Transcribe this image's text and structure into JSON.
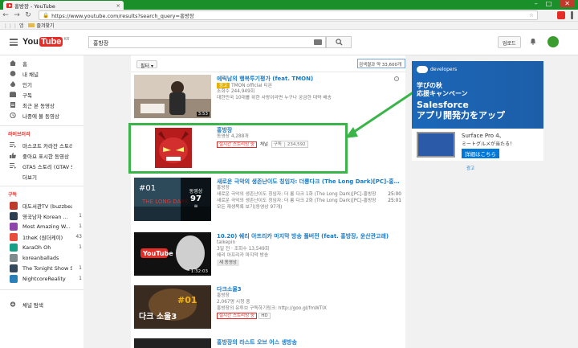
{
  "browser": {
    "tab_title": "홍방장 - YouTube",
    "tab_close": "×",
    "url": "https://www.youtube.com/results?search_query=홍방장",
    "bookmark_apps": "앱",
    "bookmark_folder": "즐겨찾기",
    "minimize": "–",
    "maximize": "□",
    "close": "✕"
  },
  "header": {
    "logo_you": "You",
    "logo_tube": "Tube",
    "logo_region": "KR",
    "search_value": "홍방장",
    "upload_label": "업로드"
  },
  "sidebar": {
    "nav": [
      {
        "label": "홈",
        "icon": "home-icon"
      },
      {
        "label": "내 채널",
        "icon": "user-icon"
      },
      {
        "label": "인기",
        "icon": "fire-icon"
      },
      {
        "label": "구독",
        "icon": "subscriptions-icon"
      },
      {
        "label": "최근 본 동영상",
        "icon": "history-icon"
      },
      {
        "label": "나중에 볼 동영상",
        "icon": "clock-icon"
      }
    ],
    "library_heading": "라이브러리",
    "library": [
      {
        "label": "마스코트 카라잔 스토리"
      },
      {
        "label": "좋아요 표시한 동영상"
      },
      {
        "label": "GTA5 스토리 (GTAV St..."
      },
      {
        "label": "더보기"
      }
    ],
    "subs_heading": "구독",
    "subs": [
      {
        "label": "대도서관TV (buzzbea...",
        "count": "",
        "color": "#c0392b"
      },
      {
        "label": "영국남자 Korean ...",
        "count": "1",
        "color": "#2c3e50"
      },
      {
        "label": "Most Amazing W...",
        "count": "1",
        "color": "#8e44ad"
      },
      {
        "label": "1theK (원더케이)",
        "count": "43",
        "color": "#e74c3c"
      },
      {
        "label": "KaraOh Oh",
        "count": "1",
        "color": "#16a085"
      },
      {
        "label": "koreanballads",
        "count": "",
        "color": "#7f8c8d"
      },
      {
        "label": "The Tonight Show Sta...",
        "count": "1",
        "color": "#34495e"
      },
      {
        "label": "NightcoreReality",
        "count": "1",
        "color": "#2980b9"
      }
    ],
    "browse_channels": "채널 탐색"
  },
  "results": {
    "filter_label": "필터 ▾",
    "count_text": "검색결과 약 33,600개",
    "items": [
      {
        "title": "에릭남의 행복투기평가 (feat. TMON)",
        "line1_badge": "광고",
        "line1": "TMON official 티몬",
        "line2": "조회수 244,949회",
        "line3": "대한민국 10대를 위한 사랑이라면 누구나 궁금한 대략 배송",
        "duration": "3:53",
        "info": "i"
      },
      {
        "title": "홍방장",
        "line1": "동영상 4,288개",
        "live_badge": "실시간 스트리밍 중",
        "channel_label": "채널",
        "subscribe_label": "구독",
        "subscribe_count": "234,592"
      },
      {
        "title": "새로운 극악의 생존난이도 칭임자: 더롱다크 (The Long Dark)[PC]-홍방장",
        "line1": "홍방장",
        "line2": "새로운 극악의 생존난이도 칭임자: 더 롱 다크 1화 (The Long Dark)[PC]-홍방장",
        "line3": "새로운 극악의 생존난이도 칭임자: 더 롱 다크 2화 (The Long Dark)[PC]-홍방장",
        "line4": "모든 재생목록 보기(동영상 97개)",
        "time1": "25:00",
        "time2": "25:01",
        "playlist_count": "97",
        "playlist_unit": "동영상"
      },
      {
        "title": "10.20) 쉐리 아프리카 마지막 방송 풀버전 (feat. 홍방장, 윤산관고래)",
        "line1": "talkepin",
        "line2": "3일 전 · 조회수 13,549회",
        "line3": "쉐리 아프리카 마지막 방송",
        "badge": "새 동영상",
        "duration": "1:32:03"
      },
      {
        "title": "다크소울3",
        "line1": "홍방장",
        "line2": "2,067명 시청 중",
        "line3": "홍방장의 유투브 구독하기링크: http://goo.gl/fmWTIX",
        "live_badge": "실시간 스트리밍 중",
        "hd_badge": "HD"
      },
      {
        "title": "홍방장의 라스트 오브 어스 생방송",
        "line1": "",
        "line2": "",
        "line3": ""
      }
    ]
  },
  "ad": {
    "developers": "developers",
    "line_a": "学びの秋",
    "line_b": "応援キャンペーン",
    "line_c": "Salesforce",
    "line_d": "アプリ開発力をアップ",
    "surface_title": "Surface Pro 4、",
    "surface_sub": "ミートグルメが当たる！",
    "surface_btn": "詳細はこちら",
    "label": "광고"
  },
  "colors": {
    "chrome_green": "#1a8f2a",
    "yt_red": "#e52d27",
    "link_blue": "#167ac6",
    "highlight_green": "#3bb54a"
  }
}
